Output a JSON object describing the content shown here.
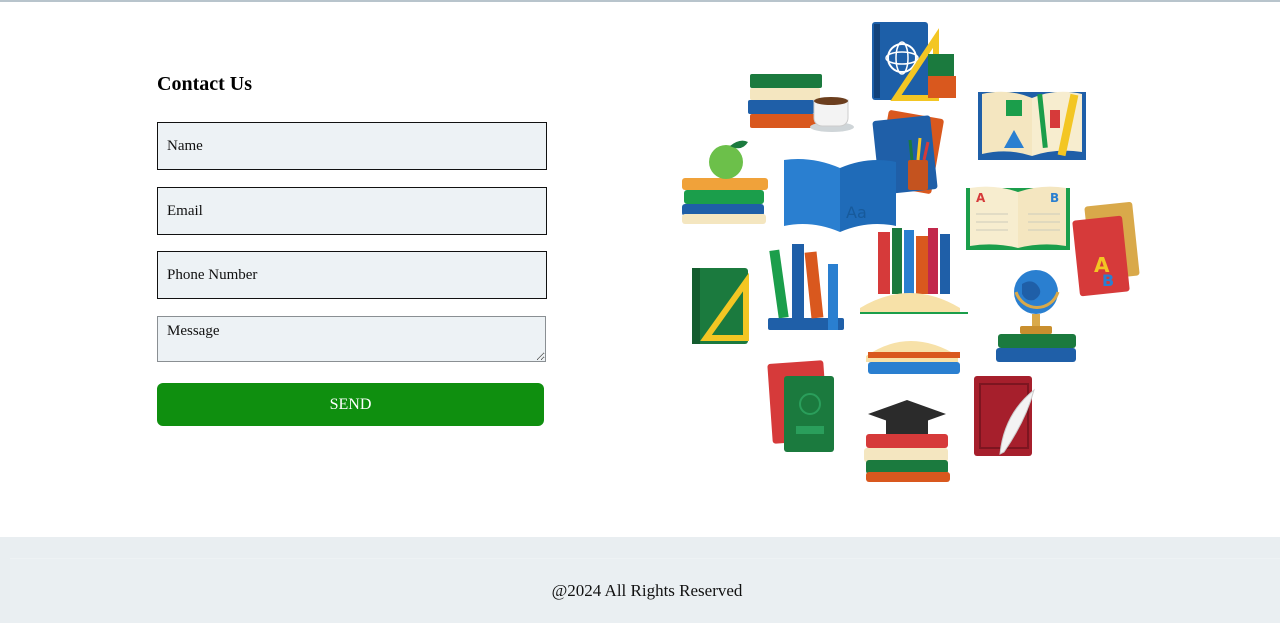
{
  "contact": {
    "title": "Contact Us",
    "name_placeholder": "Name",
    "email_placeholder": "Email",
    "phone_placeholder": "Phone Number",
    "message_placeholder": "Message",
    "send_label": "SEND"
  },
  "illustration": {
    "icon": "books-illustration"
  },
  "footer": {
    "text": "@2024 All Rights Reserved"
  },
  "colors": {
    "send_button": "#0f8f0f",
    "input_background": "#edf2f5",
    "footer_background": "#e9eef1"
  }
}
